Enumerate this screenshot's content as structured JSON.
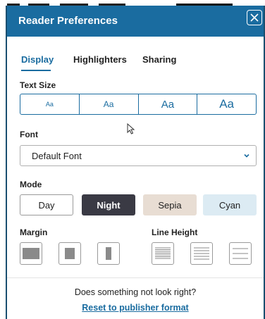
{
  "header": {
    "title": "Reader Preferences"
  },
  "tabs": [
    {
      "label": "Display",
      "active": true
    },
    {
      "label": "Highlighters",
      "active": false
    },
    {
      "label": "Sharing",
      "active": false
    }
  ],
  "text_size": {
    "label": "Text Size",
    "options": [
      "Aa",
      "Aa",
      "Aa",
      "Aa"
    ],
    "selected": 0
  },
  "font": {
    "label": "Font",
    "value": "Default Font"
  },
  "mode": {
    "label": "Mode",
    "options": [
      {
        "label": "Day",
        "bg": "#ffffff",
        "fg": "#222222"
      },
      {
        "label": "Night",
        "bg": "#3a3a44",
        "fg": "#ffffff"
      },
      {
        "label": "Sepia",
        "bg": "#e8ddd3",
        "fg": "#222222"
      },
      {
        "label": "Cyan",
        "bg": "#dcebf3",
        "fg": "#222222"
      }
    ]
  },
  "margin": {
    "label": "Margin",
    "icons": [
      "margin-small-icon",
      "margin-medium-icon",
      "margin-large-icon"
    ]
  },
  "line_height": {
    "label": "Line Height",
    "icons": [
      "line-height-compact-icon",
      "line-height-normal-icon",
      "line-height-loose-icon"
    ]
  },
  "footer": {
    "question": "Does something not look right?",
    "link": "Reset to publisher format"
  },
  "colors": {
    "accent": "#1a6ca0",
    "header": "#1a6ca0",
    "border": "#1a4f70"
  }
}
